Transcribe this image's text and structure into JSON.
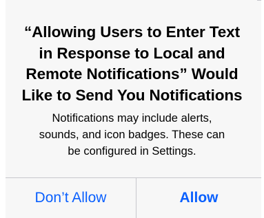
{
  "alert": {
    "title_lines": [
      "“Allowing Users to Enter Text",
      "in Response to Local and",
      "Remote Notifications” Would",
      "Like to Send You Notifications"
    ],
    "message_lines": [
      "Notifications may include alerts,",
      "sounds, and icon badges. These can",
      "be configured in Settings."
    ],
    "buttons": {
      "cancel_label": "Don’t Allow",
      "allow_label": "Allow"
    }
  },
  "colors": {
    "accent": "#0a60fe",
    "background": "#f7f7f7",
    "separator": "#c7c7cc"
  }
}
